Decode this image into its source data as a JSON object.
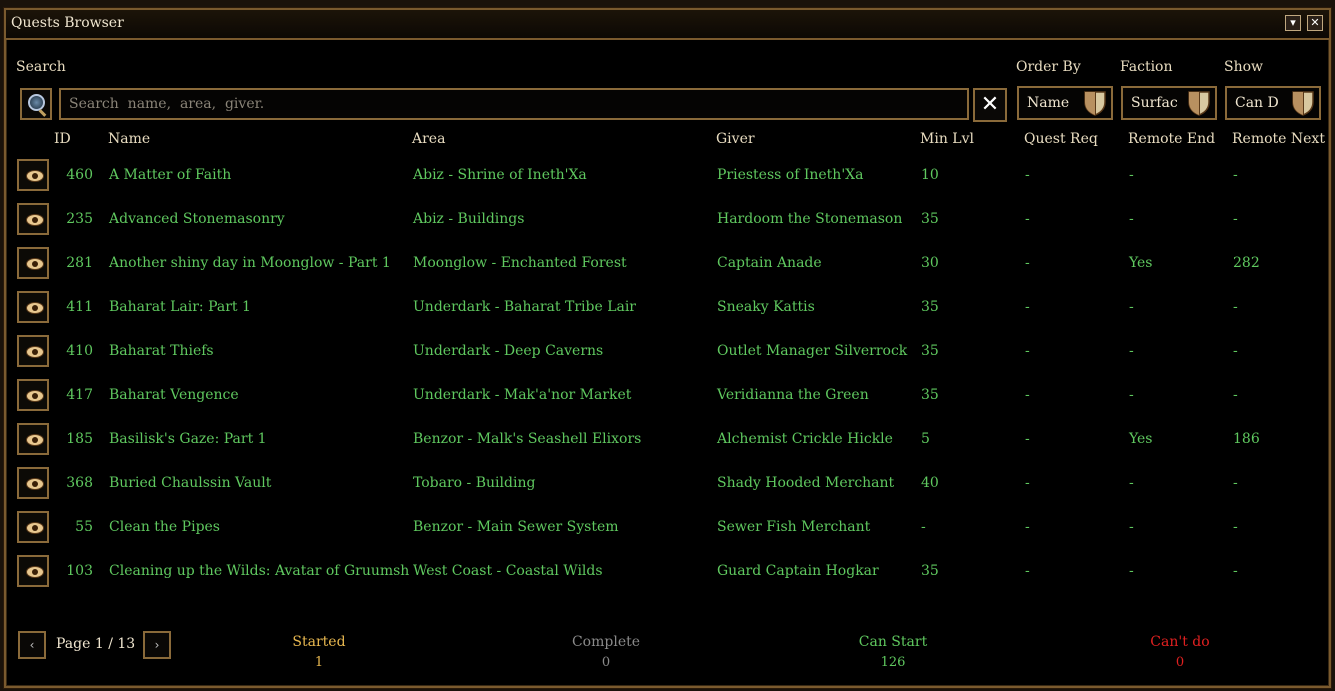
{
  "window": {
    "title": "Quests Browser"
  },
  "labels": {
    "search": "Search",
    "order_by": "Order By",
    "faction": "Faction",
    "show": "Show"
  },
  "search": {
    "placeholder": "Search  name,  area,  giver.",
    "value": ""
  },
  "dropdowns": {
    "order_by": "Name",
    "faction": "Surfac",
    "show": "Can D"
  },
  "columns": [
    "ID",
    "Name",
    "Area",
    "Giver",
    "Min  Lvl",
    "Quest  Req",
    "Remote  End",
    "Remote  Next"
  ],
  "rows": [
    {
      "id": "460",
      "name": "A  Matter  of  Faith",
      "area": "Abiz  -  Shrine  of  Ineth'Xa",
      "giver": "Priestess  of  Ineth'Xa",
      "min_lvl": "10",
      "quest_req": "-",
      "remote_end": "-",
      "remote_next": "-"
    },
    {
      "id": "235",
      "name": "Advanced  Stonemasonry",
      "area": "Abiz  -  Buildings",
      "giver": "Hardoom  the  Stonemason",
      "min_lvl": "35",
      "quest_req": "-",
      "remote_end": "-",
      "remote_next": "-"
    },
    {
      "id": "281",
      "name": "Another  shiny  day  in  Moonglow  -  Part  1",
      "area": "Moonglow  -  Enchanted  Forest",
      "giver": "Captain  Anade",
      "min_lvl": "30",
      "quest_req": "-",
      "remote_end": "Yes",
      "remote_next": "282"
    },
    {
      "id": "411",
      "name": "Baharat  Lair:  Part  1",
      "area": "Underdark  -  Baharat  Tribe  Lair",
      "giver": "Sneaky  Kattis",
      "min_lvl": "35",
      "quest_req": "-",
      "remote_end": "-",
      "remote_next": "-"
    },
    {
      "id": "410",
      "name": "Baharat  Thiefs",
      "area": "Underdark  -  Deep  Caverns",
      "giver": "Outlet  Manager  Silverrock",
      "min_lvl": "35",
      "quest_req": "-",
      "remote_end": "-",
      "remote_next": "-"
    },
    {
      "id": "417",
      "name": "Baharat  Vengence",
      "area": "Underdark  -  Mak'a'nor  Market",
      "giver": "Veridianna  the  Green",
      "min_lvl": "35",
      "quest_req": "-",
      "remote_end": "-",
      "remote_next": "-"
    },
    {
      "id": "185",
      "name": "Basilisk's  Gaze:  Part  1",
      "area": "Benzor  -  Malk's  Seashell  Elixors",
      "giver": "Alchemist  Crickle  Hickle",
      "min_lvl": "5",
      "quest_req": "-",
      "remote_end": "Yes",
      "remote_next": "186"
    },
    {
      "id": "368",
      "name": "Buried  Chaulssin  Vault",
      "area": "Tobaro  -  Building",
      "giver": "Shady  Hooded  Merchant",
      "min_lvl": "40",
      "quest_req": "-",
      "remote_end": "-",
      "remote_next": "-"
    },
    {
      "id": "55",
      "name": "Clean  the  Pipes",
      "area": "Benzor  -  Main  Sewer  System",
      "giver": "Sewer  Fish  Merchant",
      "min_lvl": "-",
      "quest_req": "-",
      "remote_end": "-",
      "remote_next": "-"
    },
    {
      "id": "103",
      "name": "Cleaning  up  the  Wilds:  Avatar  of  Gruumsh",
      "area": "West  Coast  -  Coastal  Wilds",
      "giver": "Guard  Captain  Hogkar",
      "min_lvl": "35",
      "quest_req": "-",
      "remote_end": "-",
      "remote_next": "-"
    }
  ],
  "pager": {
    "prev": "‹",
    "next": "›",
    "label": "Page  1  /  13"
  },
  "stats": [
    {
      "label": "Started",
      "value": "1",
      "color": "#e8b850"
    },
    {
      "label": "Complete",
      "value": "0",
      "color": "#8a8a8a"
    },
    {
      "label": "Can  Start",
      "value": "126",
      "color": "#5fc85f"
    },
    {
      "label": "Can't  do",
      "value": "0",
      "color": "#e02020"
    }
  ],
  "colors": {
    "border": "#8a6a3a",
    "row_text": "#5fc85f",
    "background": "#000000"
  },
  "icons": {
    "search": "magnifier-icon",
    "clear": "close-x-icon",
    "dropdown": "shield-icon",
    "row": "eye-icon",
    "minimize": "minimize-icon",
    "close": "close-icon"
  }
}
